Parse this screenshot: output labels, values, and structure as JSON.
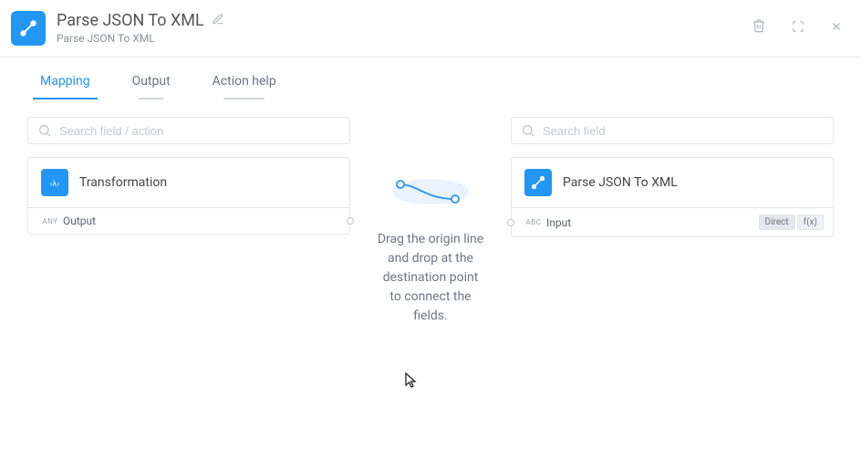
{
  "header": {
    "title": "Parse JSON To XML",
    "subtitle": "Parse JSON To XML"
  },
  "tabs": [
    {
      "label": "Mapping",
      "active": true
    },
    {
      "label": "Output",
      "active": false
    },
    {
      "label": "Action help",
      "active": false
    }
  ],
  "left": {
    "search_placeholder": "Search field / action",
    "card_title": "Transformation",
    "field_type": "ANY",
    "field_name": "Output"
  },
  "right": {
    "search_placeholder": "Search field",
    "card_title": "Parse JSON To XML",
    "field_type": "ABC",
    "field_name": "Input",
    "btn_direct": "Direct",
    "btn_fx": "f(x)"
  },
  "hint": "Drag the origin line and drop at the destination point to connect the fields."
}
